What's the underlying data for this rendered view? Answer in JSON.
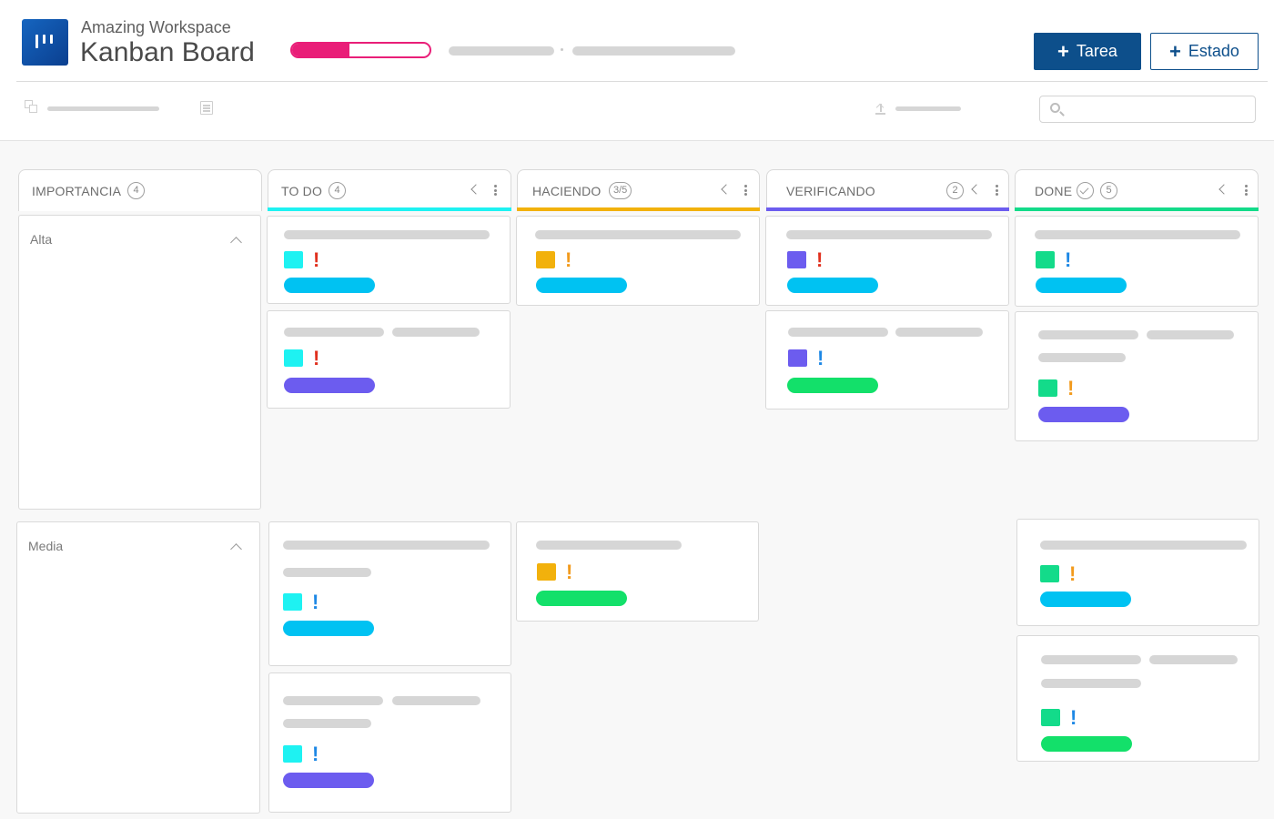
{
  "header": {
    "workspace": "Amazing Workspace",
    "title": "Kanban Board",
    "progress_fraction": 0.42,
    "new_task_label": "Tarea",
    "new_status_label": "Estado"
  },
  "search": {
    "placeholder": ""
  },
  "colors": {
    "primary": "#0d4f8b",
    "progress": "#e91e78",
    "todo": "#1ef2f2",
    "doing": "#f2b10c",
    "verifying": "#6c5cef",
    "done": "#13db8a",
    "high": "#e0301e",
    "medium": "#f29a1c",
    "low": "#1e88e5",
    "tag_blue": "#00c2f2",
    "tag_purple": "#6c5cef",
    "tag_green": "#13e06a"
  },
  "group_column": {
    "title": "IMPORTANCIA",
    "count": "4"
  },
  "columns": [
    {
      "title": "TO DO",
      "count": "4"
    },
    {
      "title": "HACIENDO",
      "count": "3/5"
    },
    {
      "title": "VERIFICANDO",
      "count": "2"
    },
    {
      "title": "DONE",
      "count": "5"
    }
  ],
  "lanes": [
    {
      "label": "Alta"
    },
    {
      "label": "Media"
    }
  ],
  "card_mark": "!"
}
